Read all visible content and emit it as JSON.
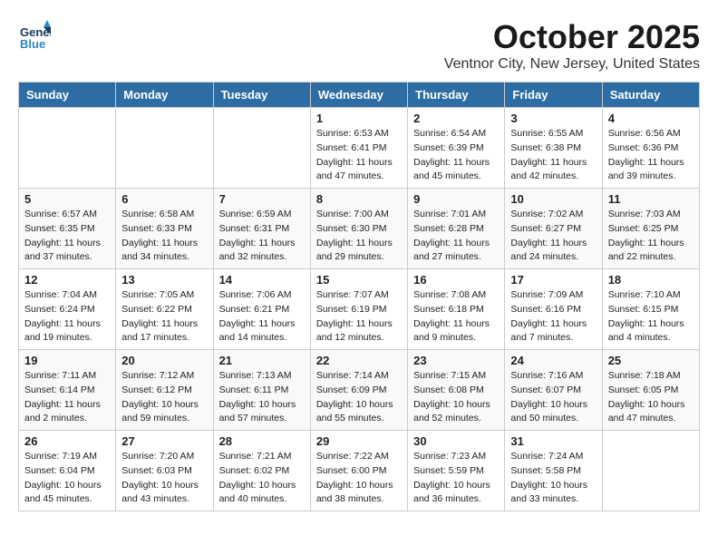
{
  "header": {
    "logo_line1": "General",
    "logo_line2": "Blue",
    "month": "October 2025",
    "location": "Ventnor City, New Jersey, United States"
  },
  "weekdays": [
    "Sunday",
    "Monday",
    "Tuesday",
    "Wednesday",
    "Thursday",
    "Friday",
    "Saturday"
  ],
  "weeks": [
    [
      {
        "day": "",
        "info": ""
      },
      {
        "day": "",
        "info": ""
      },
      {
        "day": "",
        "info": ""
      },
      {
        "day": "1",
        "info": "Sunrise: 6:53 AM\nSunset: 6:41 PM\nDaylight: 11 hours\nand 47 minutes."
      },
      {
        "day": "2",
        "info": "Sunrise: 6:54 AM\nSunset: 6:39 PM\nDaylight: 11 hours\nand 45 minutes."
      },
      {
        "day": "3",
        "info": "Sunrise: 6:55 AM\nSunset: 6:38 PM\nDaylight: 11 hours\nand 42 minutes."
      },
      {
        "day": "4",
        "info": "Sunrise: 6:56 AM\nSunset: 6:36 PM\nDaylight: 11 hours\nand 39 minutes."
      }
    ],
    [
      {
        "day": "5",
        "info": "Sunrise: 6:57 AM\nSunset: 6:35 PM\nDaylight: 11 hours\nand 37 minutes."
      },
      {
        "day": "6",
        "info": "Sunrise: 6:58 AM\nSunset: 6:33 PM\nDaylight: 11 hours\nand 34 minutes."
      },
      {
        "day": "7",
        "info": "Sunrise: 6:59 AM\nSunset: 6:31 PM\nDaylight: 11 hours\nand 32 minutes."
      },
      {
        "day": "8",
        "info": "Sunrise: 7:00 AM\nSunset: 6:30 PM\nDaylight: 11 hours\nand 29 minutes."
      },
      {
        "day": "9",
        "info": "Sunrise: 7:01 AM\nSunset: 6:28 PM\nDaylight: 11 hours\nand 27 minutes."
      },
      {
        "day": "10",
        "info": "Sunrise: 7:02 AM\nSunset: 6:27 PM\nDaylight: 11 hours\nand 24 minutes."
      },
      {
        "day": "11",
        "info": "Sunrise: 7:03 AM\nSunset: 6:25 PM\nDaylight: 11 hours\nand 22 minutes."
      }
    ],
    [
      {
        "day": "12",
        "info": "Sunrise: 7:04 AM\nSunset: 6:24 PM\nDaylight: 11 hours\nand 19 minutes."
      },
      {
        "day": "13",
        "info": "Sunrise: 7:05 AM\nSunset: 6:22 PM\nDaylight: 11 hours\nand 17 minutes."
      },
      {
        "day": "14",
        "info": "Sunrise: 7:06 AM\nSunset: 6:21 PM\nDaylight: 11 hours\nand 14 minutes."
      },
      {
        "day": "15",
        "info": "Sunrise: 7:07 AM\nSunset: 6:19 PM\nDaylight: 11 hours\nand 12 minutes."
      },
      {
        "day": "16",
        "info": "Sunrise: 7:08 AM\nSunset: 6:18 PM\nDaylight: 11 hours\nand 9 minutes."
      },
      {
        "day": "17",
        "info": "Sunrise: 7:09 AM\nSunset: 6:16 PM\nDaylight: 11 hours\nand 7 minutes."
      },
      {
        "day": "18",
        "info": "Sunrise: 7:10 AM\nSunset: 6:15 PM\nDaylight: 11 hours\nand 4 minutes."
      }
    ],
    [
      {
        "day": "19",
        "info": "Sunrise: 7:11 AM\nSunset: 6:14 PM\nDaylight: 11 hours\nand 2 minutes."
      },
      {
        "day": "20",
        "info": "Sunrise: 7:12 AM\nSunset: 6:12 PM\nDaylight: 10 hours\nand 59 minutes."
      },
      {
        "day": "21",
        "info": "Sunrise: 7:13 AM\nSunset: 6:11 PM\nDaylight: 10 hours\nand 57 minutes."
      },
      {
        "day": "22",
        "info": "Sunrise: 7:14 AM\nSunset: 6:09 PM\nDaylight: 10 hours\nand 55 minutes."
      },
      {
        "day": "23",
        "info": "Sunrise: 7:15 AM\nSunset: 6:08 PM\nDaylight: 10 hours\nand 52 minutes."
      },
      {
        "day": "24",
        "info": "Sunrise: 7:16 AM\nSunset: 6:07 PM\nDaylight: 10 hours\nand 50 minutes."
      },
      {
        "day": "25",
        "info": "Sunrise: 7:18 AM\nSunset: 6:05 PM\nDaylight: 10 hours\nand 47 minutes."
      }
    ],
    [
      {
        "day": "26",
        "info": "Sunrise: 7:19 AM\nSunset: 6:04 PM\nDaylight: 10 hours\nand 45 minutes."
      },
      {
        "day": "27",
        "info": "Sunrise: 7:20 AM\nSunset: 6:03 PM\nDaylight: 10 hours\nand 43 minutes."
      },
      {
        "day": "28",
        "info": "Sunrise: 7:21 AM\nSunset: 6:02 PM\nDaylight: 10 hours\nand 40 minutes."
      },
      {
        "day": "29",
        "info": "Sunrise: 7:22 AM\nSunset: 6:00 PM\nDaylight: 10 hours\nand 38 minutes."
      },
      {
        "day": "30",
        "info": "Sunrise: 7:23 AM\nSunset: 5:59 PM\nDaylight: 10 hours\nand 36 minutes."
      },
      {
        "day": "31",
        "info": "Sunrise: 7:24 AM\nSunset: 5:58 PM\nDaylight: 10 hours\nand 33 minutes."
      },
      {
        "day": "",
        "info": ""
      }
    ]
  ]
}
